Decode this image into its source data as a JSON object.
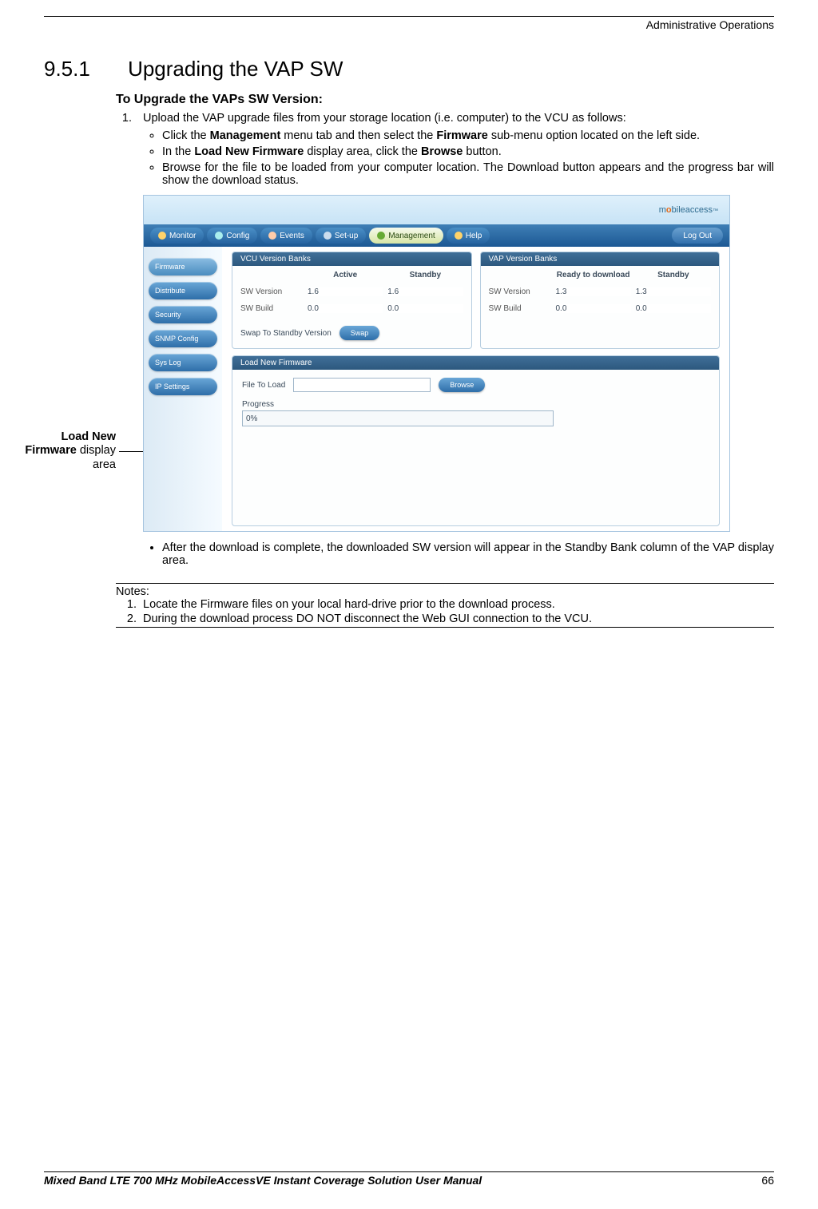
{
  "header": {
    "right": "Administrative Operations"
  },
  "section": {
    "number": "9.5.1",
    "title": "Upgrading the VAP SW"
  },
  "subheading": "To Upgrade the VAPs SW Version:",
  "step1": {
    "text_before": "Upload the VAP upgrade files from your storage location (i.e. computer) to the VCU as follows:",
    "bullet1_pre": "Click the ",
    "bullet1_b1": "Management",
    "bullet1_mid": " menu tab and then select the ",
    "bullet1_b2": "Firmware",
    "bullet1_post": " sub-menu option located on the left side.",
    "bullet2_pre": "In the ",
    "bullet2_b1": "Load New Firmware",
    "bullet2_mid": " display area, click the ",
    "bullet2_b2": "Browse",
    "bullet2_post": " button.",
    "bullet3": "Browse for the file to be loaded from your computer location. The Download button appears and the progress bar will show the download status.",
    "bullet4": "After the download is complete, the downloaded SW version will appear in the Standby Bank column of the VAP display area."
  },
  "callout": {
    "line1_b": "Load New",
    "line2_b": "Firmware",
    "line2_rest": " display",
    "line3": "area"
  },
  "screenshot": {
    "brand_pre": "m",
    "brand_dot": "o",
    "brand_post": "bileaccess",
    "nav": {
      "monitor": "Monitor",
      "config": "Config",
      "events": "Events",
      "setup": "Set-up",
      "management": "Management",
      "help": "Help",
      "logout": "Log Out"
    },
    "sidebar": {
      "firmware": "Firmware",
      "distribute": "Distribute",
      "security": "Security",
      "snmp": "SNMP Config",
      "syslog": "Sys Log",
      "ipsettings": "IP Settings"
    },
    "vcu_panel_title": "VCU Version Banks",
    "vap_panel_title": "VAP Version Banks",
    "col_active": "Active",
    "col_standby": "Standby",
    "col_ready": "Ready to download",
    "row_swver": "SW Version",
    "row_swbuild": "SW Build",
    "vcu_active_ver": "1.6",
    "vcu_standby_ver": "1.6",
    "vcu_active_build": "0.0",
    "vcu_standby_build": "0.0",
    "vap_ready_ver": "1.3",
    "vap_standby_ver": "1.3",
    "vap_ready_build": "0.0",
    "vap_standby_build": "0.0",
    "swap_label": "Swap To Standby Version",
    "swap_btn": "Swap",
    "load_panel_title": "Load New Firmware",
    "file_to_load": "File To Load",
    "browse_btn": "Browse",
    "progress_label": "Progress",
    "progress_value": "0%"
  },
  "notes": {
    "heading": "Notes:",
    "n1": "Locate the Firmware files on your local hard-drive prior to the download process.",
    "n2": "During the download process DO NOT disconnect the Web GUI connection to the VCU."
  },
  "footer": {
    "title": "Mixed Band LTE 700 MHz MobileAccessVE Instant Coverage Solution User Manual",
    "page": "66"
  }
}
